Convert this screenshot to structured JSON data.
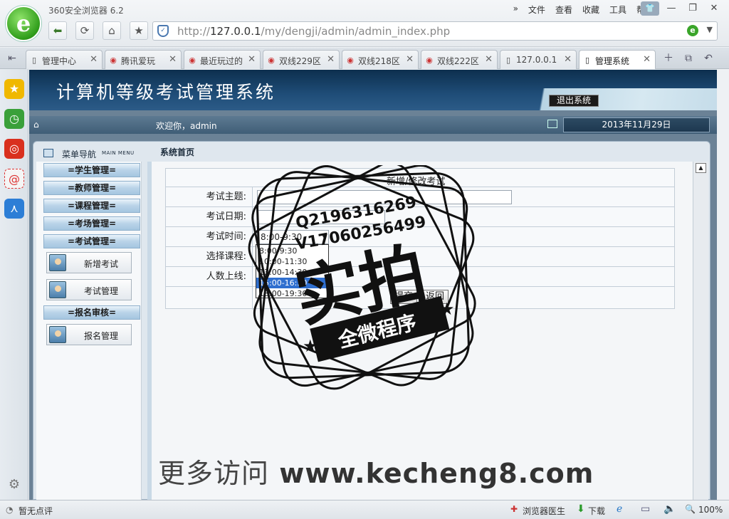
{
  "browser": {
    "name": "360安全浏览器 6.2",
    "logo_letter": "e",
    "menus": [
      "文件",
      "查看",
      "收藏",
      "工具",
      "帮助"
    ],
    "address_prefix": "http://",
    "address_host": "127.0.0.1",
    "address_path": "/my/dengji/admin/admin_index.php",
    "tabs": [
      "管理中心",
      "腾讯爱玩",
      "最近玩过的",
      "双线229区",
      "双线218区",
      "双线222区",
      "127.0.0.1",
      "管理系统"
    ],
    "status_left": "暂无点评",
    "status_doctor": "浏览器医生",
    "status_download": "下载",
    "zoom": "100%"
  },
  "page": {
    "system_title": "计算机等级考试管理系统",
    "logout_label": "退出系统",
    "welcome": "欢迎你，admin",
    "date": "2013年11月29日",
    "menu_title": "菜单导航",
    "menu_title_en": "MAIN MENU",
    "breadcrumb": "系统首页",
    "menu_groups": [
      {
        "label": "=学生管理="
      },
      {
        "label": "=教师管理="
      },
      {
        "label": "=课程管理="
      },
      {
        "label": "=考场管理="
      },
      {
        "label": "=考试管理="
      },
      {
        "label": "=报名审核="
      }
    ],
    "menu_items": [
      "新增考试",
      "考试管理",
      "报名管理"
    ]
  },
  "form": {
    "title": "新增/修改考试",
    "labels": {
      "subject": "考试主题:",
      "date": "考试日期:",
      "time": "考试时间:",
      "course": "选择课程:",
      "limit": "人数上线:"
    },
    "time_selected": "8:00-9:30",
    "time_options": [
      "8:00-9:30",
      "10:00-11:30",
      "13:00-14:30",
      "15:00-16:30",
      "18:00-19:30"
    ],
    "highlighted_option_index": 3,
    "submit_label": "提交",
    "back_label": "返回"
  },
  "watermark": {
    "qq": "Q2196316269",
    "v": "V17060256499",
    "big": "实拍",
    "banner": "全微程序",
    "site_cn": "更多访问",
    "site_url": "www.kecheng8.com"
  }
}
